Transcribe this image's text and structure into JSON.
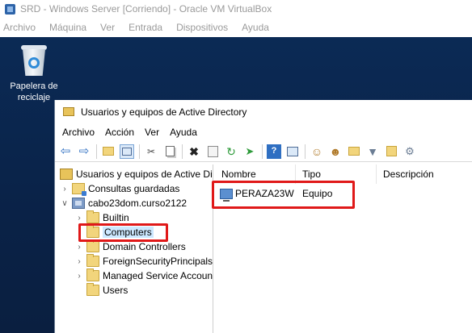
{
  "vbox": {
    "title": "SRD - Windows Server [Corriendo] - Oracle VM VirtualBox",
    "menu": [
      "Archivo",
      "Máquina",
      "Ver",
      "Entrada",
      "Dispositivos",
      "Ayuda"
    ]
  },
  "desktop": {
    "recycle_bin_label_line1": "Papelera de",
    "recycle_bin_label_line2": "reciclaje",
    "background_color": "#0b2a55"
  },
  "ad_window": {
    "title": "Usuarios y equipos de Active Directory",
    "menu": [
      "Archivo",
      "Acción",
      "Ver",
      "Ayuda"
    ],
    "toolbar_icons": [
      "back-icon",
      "forward-icon",
      "up-folder-icon",
      "console-tree-icon",
      "cut-icon",
      "copy-icon",
      "delete-icon",
      "properties-icon",
      "refresh-icon",
      "export-list-icon",
      "help-icon",
      "view-icon",
      "new-user-icon",
      "new-group-icon",
      "new-ou-icon",
      "filter-icon",
      "find-icon",
      "add-to-group-icon"
    ],
    "tree": {
      "root": "Usuarios y equipos de Active Directory",
      "saved_queries": "Consultas guardadas",
      "domain": "cabo23dom.curso2122",
      "children": [
        "Builtin",
        "Computers",
        "Domain Controllers",
        "ForeignSecurityPrincipals",
        "Managed Service Accounts",
        "Users"
      ],
      "selected": "Computers"
    },
    "details": {
      "columns": [
        "Nombre",
        "Tipo",
        "Descripción"
      ],
      "rows": [
        {
          "name": "PERAZA23W",
          "type": "Equipo",
          "description": ""
        }
      ]
    }
  },
  "colors": {
    "annotation_red": "#e01919",
    "selection_blue": "#cce8ff"
  }
}
